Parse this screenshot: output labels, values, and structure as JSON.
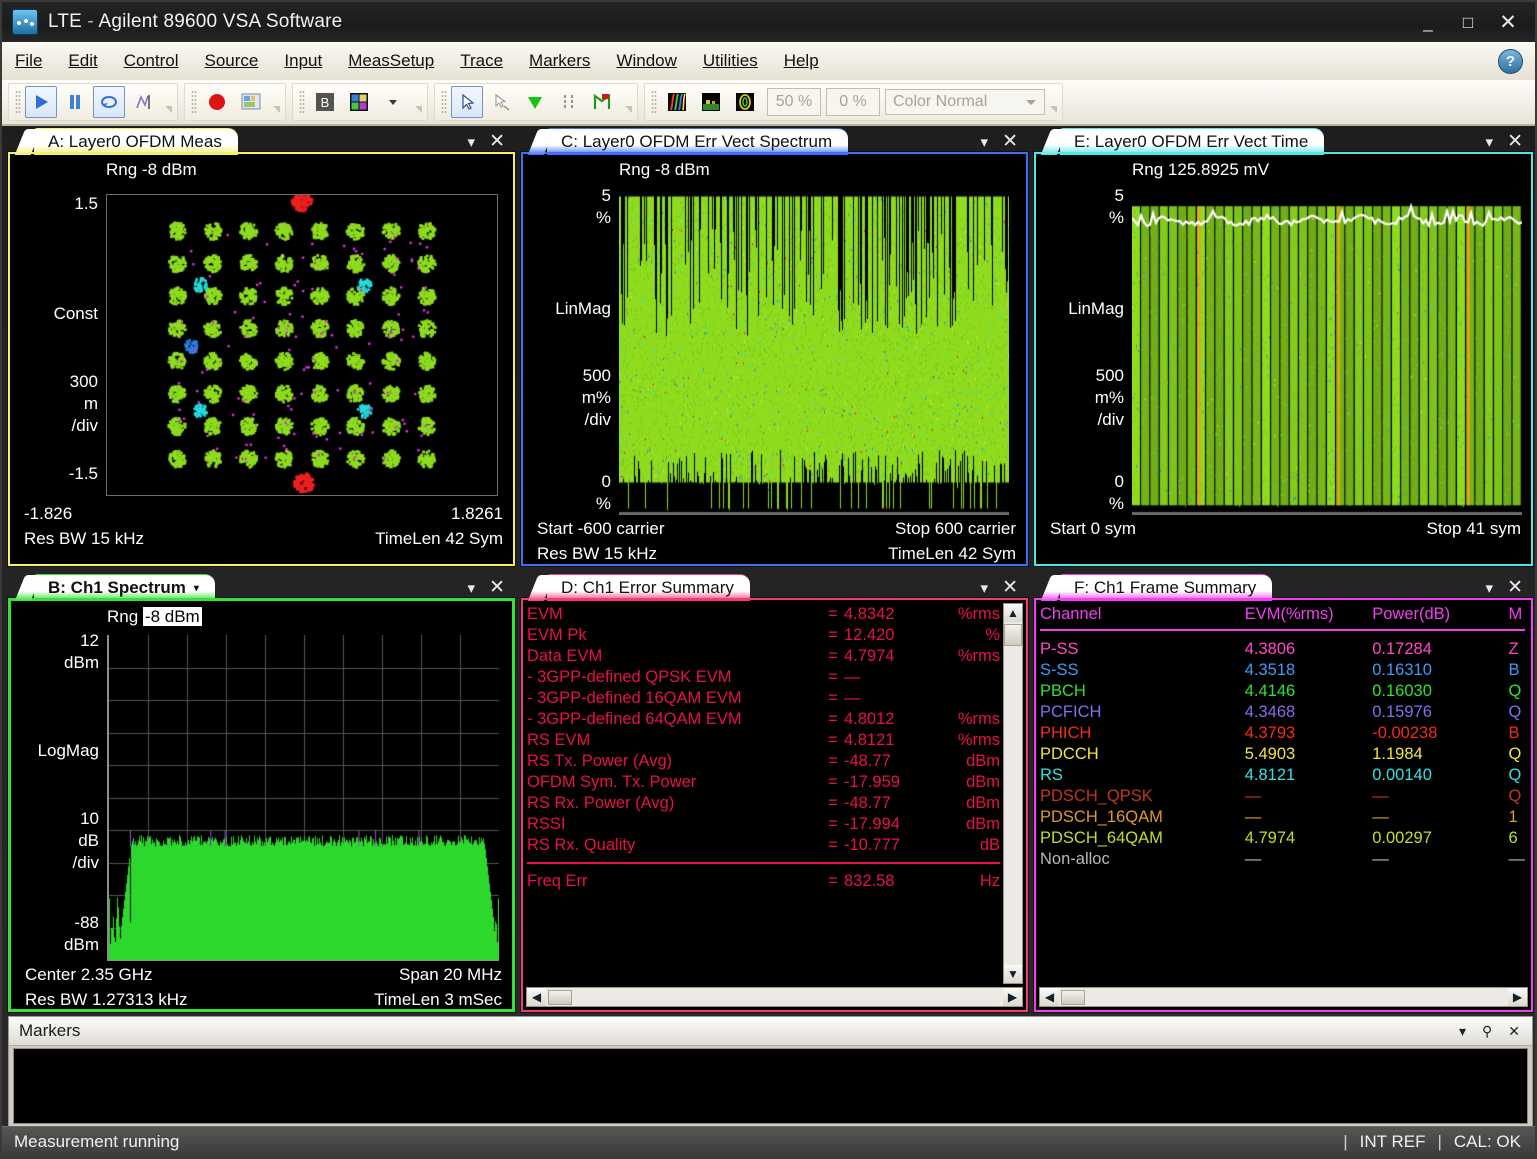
{
  "window": {
    "title_app": "LTE",
    "title_sep": "-",
    "title_product": "Agilent 89600 VSA Software",
    "minimize": "_",
    "maximize": "□",
    "close": "✕"
  },
  "menubar": {
    "items": [
      "File",
      "Edit",
      "Control",
      "Source",
      "Input",
      "MeasSetup",
      "Trace",
      "Markers",
      "Window",
      "Utilities",
      "Help"
    ],
    "help_glyph": "?"
  },
  "toolbar": {
    "percent_field_1": "50 %",
    "percent_field_2": "0 %",
    "color_combo": "Color Normal"
  },
  "panes": {
    "a": {
      "title": "A: Layer0 OFDM Meas",
      "accent": "#f5f06a",
      "rng": "Rng -8 dBm",
      "y_top": "1.5",
      "y_mid_label": "Const",
      "y_div": "300\nm\n/div",
      "y_div_1": "300",
      "y_div_2": "m",
      "y_div_3": "/div",
      "y_bottom": "-1.5",
      "foot_left_1": "-1.826",
      "foot_right_1": "1.8261",
      "foot_left_2": "Res BW 15 kHz",
      "foot_right_2": "TimeLen 42  Sym"
    },
    "b": {
      "title": "B: Ch1 Spectrum",
      "caret": "▾",
      "accent": "#35e235",
      "active": true,
      "rng_prefix": "Rng ",
      "rng_value": "-8 dBm",
      "y_top_1": "12",
      "y_top_2": "dBm",
      "y_mid_label": "LogMag",
      "y_div_1": "10",
      "y_div_2": "dB",
      "y_div_3": "/div",
      "y_bot_1": "-88",
      "y_bot_2": "dBm",
      "foot_left_1": "Center 2.35 GHz",
      "foot_right_1": "Span 20 MHz",
      "foot_left_2": "Res BW 1.27313 kHz",
      "foot_right_2": "TimeLen 3 mSec"
    },
    "c": {
      "title": "C: Layer0 OFDM Err Vect Spectrum",
      "accent": "#3d6ef5",
      "rng": "Rng -8 dBm",
      "y_top_1": "5",
      "y_top_2": "%",
      "y_mid_label": "LinMag",
      "y_div_1": "500",
      "y_div_2": "m%",
      "y_div_3": "/div",
      "y_bot_1": "0",
      "y_bot_2": "%",
      "foot_left_1": "Start -600  carrier",
      "foot_right_1": "Stop 600  carrier",
      "foot_left_2": "Res BW 15 kHz",
      "foot_right_2": "TimeLen 42  Sym"
    },
    "e": {
      "title": "E: Layer0 OFDM Err Vect Time",
      "accent": "#4fe6e6",
      "rng": "Rng 125.8925 mV",
      "y_top_1": "5",
      "y_top_2": "%",
      "y_mid_label": "LinMag",
      "y_div_1": "500",
      "y_div_2": "m%",
      "y_div_3": "/div",
      "y_bot_1": "0",
      "y_bot_2": "%",
      "foot_left_1": "Start 0  sym",
      "foot_right_1": "Stop 41  sym"
    },
    "d": {
      "title": "D: Ch1 Error Summary",
      "accent": "#f23a7a"
    },
    "f": {
      "title": "F: Ch1 Frame Summary",
      "accent": "#f03ef0"
    }
  },
  "error_summary": {
    "color": "#e8104a",
    "rows": [
      {
        "label": "EVM",
        "eq": "=",
        "value": "4.8342",
        "unit": "%rms"
      },
      {
        "label": "EVM Pk",
        "eq": "=",
        "value": "12.420",
        "unit": "%"
      },
      {
        "label": "Data EVM",
        "eq": "=",
        "value": "4.7974",
        "unit": "%rms"
      },
      {
        "label": "- 3GPP-defined QPSK EVM",
        "eq": "=",
        "value": "—",
        "unit": ""
      },
      {
        "label": "- 3GPP-defined 16QAM EVM",
        "eq": "=",
        "value": "—",
        "unit": ""
      },
      {
        "label": "- 3GPP-defined 64QAM EVM",
        "eq": "=",
        "value": "4.8012",
        "unit": "%rms"
      },
      {
        "label": "RS EVM",
        "eq": "=",
        "value": "4.8121",
        "unit": "%rms"
      },
      {
        "label": "RS Tx. Power (Avg)",
        "eq": "=",
        "value": "-48.77",
        "unit": "dBm"
      },
      {
        "label": "OFDM Sym. Tx. Power",
        "eq": "=",
        "value": "-17.959",
        "unit": "dBm"
      },
      {
        "label": "RS Rx. Power (Avg)",
        "eq": "=",
        "value": "-48.77",
        "unit": "dBm"
      },
      {
        "label": "RSSI",
        "eq": "=",
        "value": "-17.994",
        "unit": "dBm"
      },
      {
        "label": "RS Rx. Quality",
        "eq": "=",
        "value": "-10.777",
        "unit": "dB"
      }
    ],
    "rows_after_rule": [
      {
        "label": "Freq Err",
        "eq": "=",
        "value": "832.58",
        "unit": "Hz"
      }
    ]
  },
  "frame_summary": {
    "header_color": "#f03ef0",
    "headers": [
      "Channel",
      "EVM(%rms)",
      "Power(dB)",
      "M"
    ],
    "rows": [
      {
        "channel": "P-SS",
        "evm": "4.3806",
        "power": "0.17284",
        "mod": "Z",
        "color": "#ff49c8"
      },
      {
        "channel": "S-SS",
        "evm": "4.3518",
        "power": "0.16310",
        "mod": "B",
        "color": "#3e9bf5"
      },
      {
        "channel": "PBCH",
        "evm": "4.4146",
        "power": "0.16030",
        "mod": "Q",
        "color": "#2ee32e"
      },
      {
        "channel": "PCFICH",
        "evm": "4.3468",
        "power": "0.15976",
        "mod": "Q",
        "color": "#8a6bf0"
      },
      {
        "channel": "PHICH",
        "evm": "4.3793",
        "power": "-0.00238",
        "mod": "B",
        "color": "#f52a1e"
      },
      {
        "channel": "PDCCH",
        "evm": "5.4903",
        "power": "1.1984",
        "mod": "Q",
        "color": "#f0e63c"
      },
      {
        "channel": "RS",
        "evm": "4.8121",
        "power": "0.00140",
        "mod": "Q",
        "color": "#36e0e0"
      },
      {
        "channel": "PDSCH_QPSK",
        "evm": "—",
        "power": "—",
        "mod": "Q",
        "color": "#c2361e"
      },
      {
        "channel": "PDSCH_16QAM",
        "evm": "—",
        "power": "—",
        "mod": "1",
        "color": "#e09a2a"
      },
      {
        "channel": "PDSCH_64QAM",
        "evm": "4.7974",
        "power": "0.00297",
        "mod": "6",
        "color": "#bde02a"
      },
      {
        "channel": "Non-alloc",
        "evm": "—",
        "power": "—",
        "mod": "—",
        "color": "#b9b9b9"
      }
    ]
  },
  "markers": {
    "title": "Markers",
    "caret": "▾",
    "pin": "⚲",
    "close": "✕"
  },
  "statusbar": {
    "message": "Measurement running",
    "pipe": "|",
    "ref": "INT REF",
    "cal": "CAL: OK"
  }
}
